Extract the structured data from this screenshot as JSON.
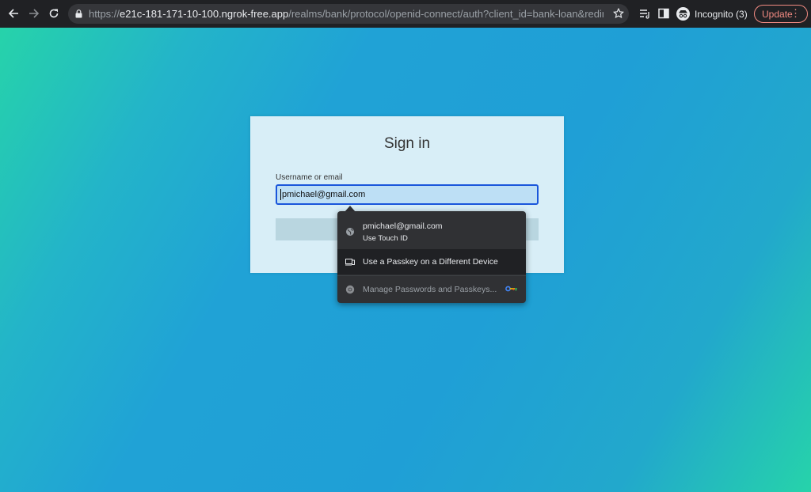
{
  "browser": {
    "url_scheme": "https://",
    "url_host": "e21c-181-171-10-100.ngrok-free.app",
    "url_path": "/realms/bank/protocol/openid-connect/auth?client_id=bank-loan&redirect_uri=...",
    "profile_label": "Incognito (3)",
    "update_label": "Update",
    "update_color": "#f28b82"
  },
  "login": {
    "title": "Sign in",
    "username_label": "Username or email",
    "username_value": "pmichael@gmail.com"
  },
  "autofill": {
    "items": [
      {
        "label": "pmichael@gmail.com",
        "sublabel": "Use Touch ID",
        "icon": "globe-icon"
      },
      {
        "label": "Use a Passkey on a Different Device",
        "icon": "devices-icon"
      },
      {
        "label": "Manage Passwords and Passkeys...",
        "icon": "chrome-icon",
        "trailing_icon": "key-icon"
      }
    ]
  },
  "colors": {
    "gradient_start": "#26d3aa",
    "gradient_mid": "#1f9fd6",
    "card_bg": "#d8eef7",
    "input_border": "#1a56db",
    "dropdown_bg": "#303134"
  }
}
